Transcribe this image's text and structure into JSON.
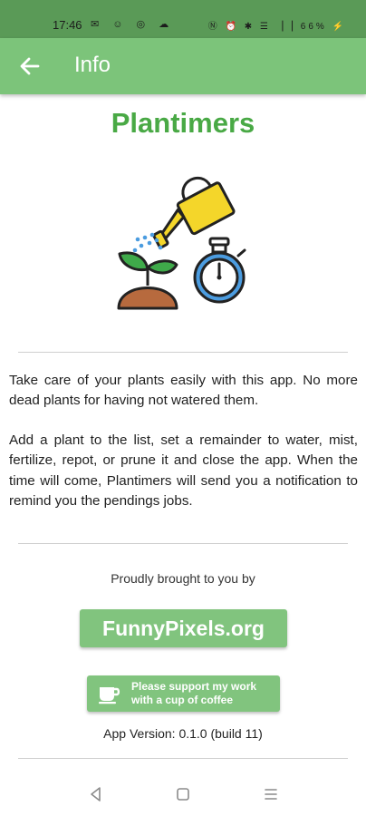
{
  "status_bar": {
    "time": "17:46",
    "left_icons": "✉ ☺ ◎ ☁",
    "right_text": "Ⓝ ⏰ ✱ ☰ ▕▕ 66% ⚡"
  },
  "app_bar": {
    "title": "Info",
    "back_icon": "arrow-left-icon",
    "background": "#7cc47a"
  },
  "main": {
    "app_name": "Plantimers",
    "illustration": "plant-watering-can-stopwatch-icon",
    "paragraphs": [
      "Take care of your plants easily with this app. No more dead plants for having not watered them.",
      "Add a plant to the list, set a remainder to water, mist, fertilize, repot,  or prune it and close the app. When the time will come, Plantimers will send you a notification to remind you the pendings jobs."
    ],
    "brought_by": "Proudly brought to you by",
    "website_button": "FunnyPixels.org",
    "coffee_button": {
      "line1": "Please support my work",
      "line2": "with a cup of coffee",
      "icon": "coffee-cup-icon"
    },
    "version": "App Version: 0.1.0 (build 11)"
  },
  "colors": {
    "accent": "#49a945",
    "button": "#81c47e",
    "status_bar": "#5a9a57"
  },
  "nav_bar": {
    "back": "nav-back-icon",
    "home": "nav-home-icon",
    "menu": "nav-menu-icon"
  }
}
